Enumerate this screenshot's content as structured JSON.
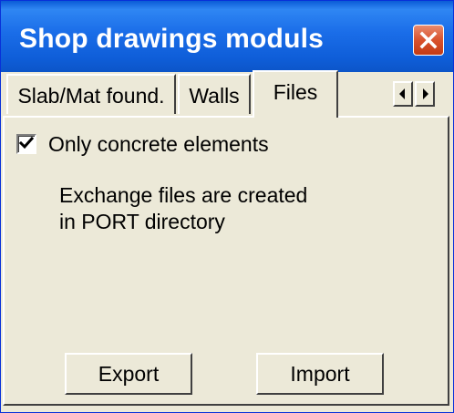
{
  "window": {
    "title": "Shop drawings moduls",
    "colors": {
      "titlebar": "#1a6de8",
      "close_button": "#d9522d",
      "face": "#ece9d8"
    }
  },
  "tabs": [
    {
      "label": "Slab/Mat found.",
      "active": false
    },
    {
      "label": "Walls",
      "active": false
    },
    {
      "label": "Files",
      "active": true
    }
  ],
  "tab_scroll": {
    "left_icon": "arrow-left-icon",
    "right_icon": "arrow-right-icon"
  },
  "files_panel": {
    "checkbox_label": "Only concrete elements",
    "checkbox_checked": true,
    "info_line_1": "Exchange files are created",
    "info_line_2": "in PORT directory"
  },
  "buttons": {
    "export_label": "Export",
    "import_label": "Import"
  }
}
